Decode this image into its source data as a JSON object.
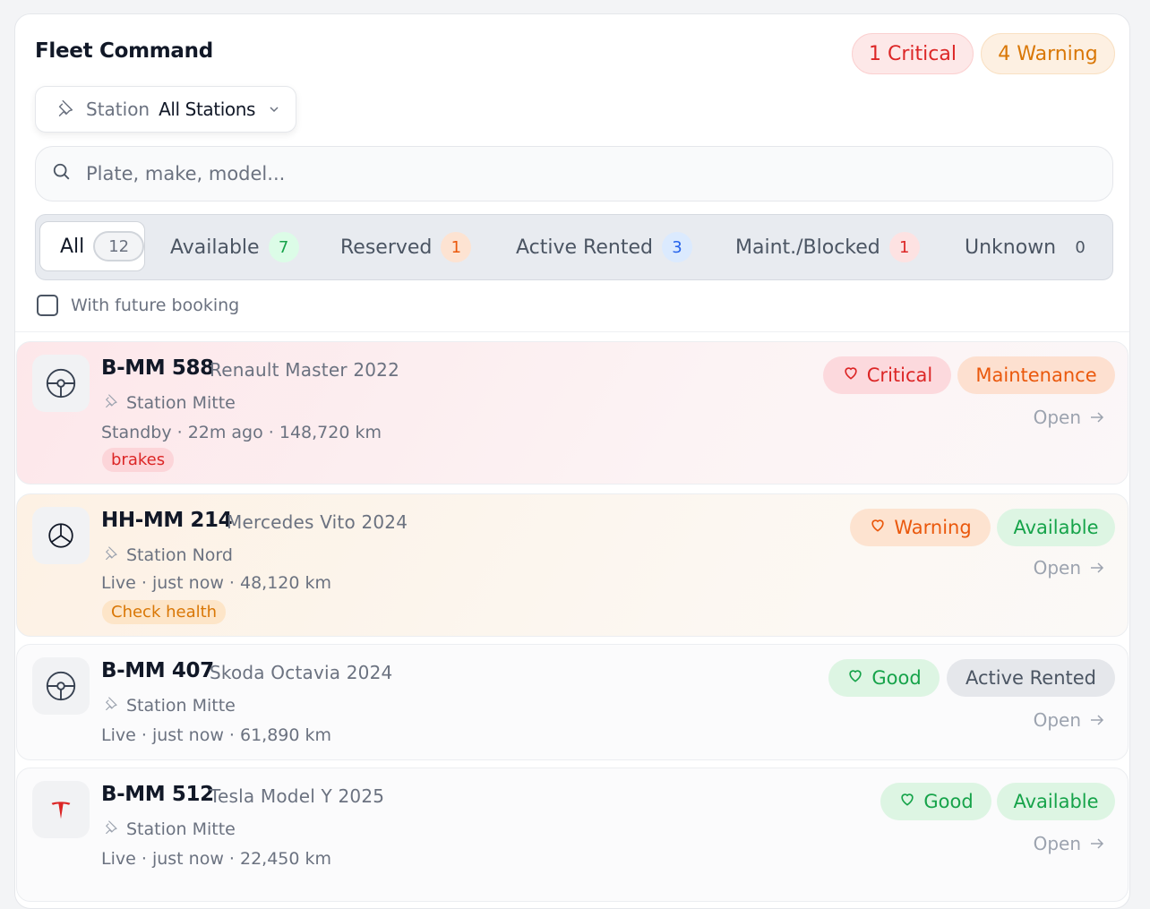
{
  "header": {
    "title": "Fleet Command",
    "critical_label": "1 Critical",
    "warning_label": "4 Warning"
  },
  "station_filter": {
    "label": "Station",
    "value": "All Stations"
  },
  "search": {
    "placeholder": "Plate, make, model..."
  },
  "tabs": [
    {
      "label": "All",
      "count": "12"
    },
    {
      "label": "Available",
      "count": "7"
    },
    {
      "label": "Reserved",
      "count": "1"
    },
    {
      "label": "Active Rented",
      "count": "3"
    },
    {
      "label": "Maint./Blocked",
      "count": "1"
    },
    {
      "label": "Unknown",
      "count": "0"
    }
  ],
  "future_booking": {
    "label": "With future booking"
  },
  "vehicles": [
    {
      "plate": "B-MM 588",
      "model": "Renault Master 2022",
      "station": "Station Mitte",
      "status": "Standby",
      "time": "22m ago",
      "mileage": "148,720 km",
      "health": "Critical",
      "availability": "Maintenance",
      "tag": "brakes",
      "open": "Open",
      "logo_icon": "renault-logo-icon"
    },
    {
      "plate": "HH-MM 214",
      "model": "Mercedes Vito 2024",
      "station": "Station Nord",
      "status": "Live",
      "time": "just now",
      "mileage": "48,120 km",
      "health": "Warning",
      "availability": "Available",
      "tag": "Check health",
      "open": "Open",
      "logo_icon": "mercedes-logo-icon"
    },
    {
      "plate": "B-MM 407",
      "model": "Skoda Octavia 2024",
      "station": "Station Mitte",
      "status": "Live",
      "time": "just now",
      "mileage": "61,890 km",
      "health": "Good",
      "availability": "Active Rented",
      "open": "Open",
      "logo_icon": "steering-wheel-icon"
    },
    {
      "plate": "B-MM 512",
      "model": "Tesla Model Y 2025",
      "station": "Station Mitte",
      "status": "Live",
      "time": "just now",
      "mileage": "22,450 km",
      "health": "Good",
      "availability": "Available",
      "open": "Open",
      "logo_icon": "tesla-logo-icon"
    }
  ],
  "colors": {
    "critical": "#dc2626",
    "warning": "#ea580c",
    "good": "#16a34a",
    "blue": "#2563eb"
  }
}
